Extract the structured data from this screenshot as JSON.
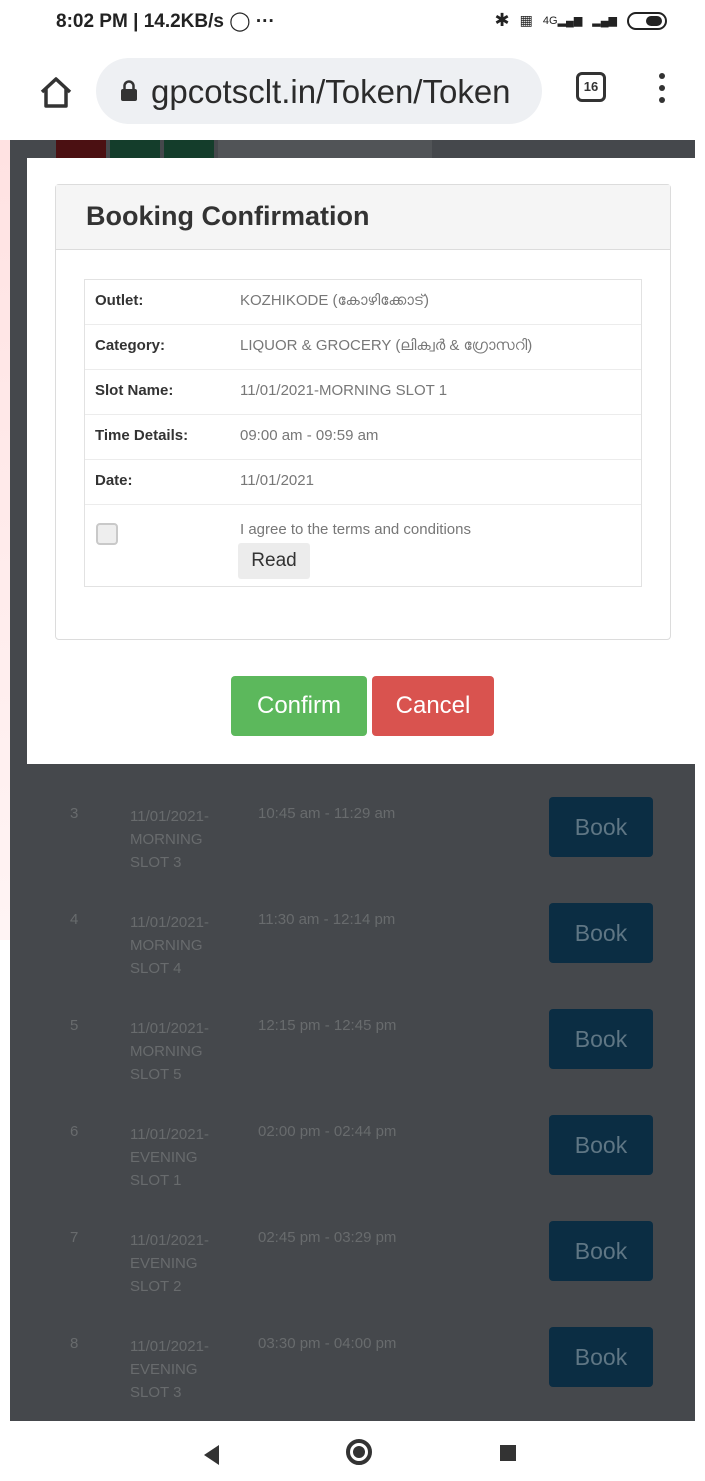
{
  "status_bar": {
    "time": "8:02 PM",
    "speed": "14.2KB/s",
    "more": "···",
    "signal_label": "4G"
  },
  "browser": {
    "url": "gpcotsclt.in/Token/Token",
    "tab_count": "16"
  },
  "modal": {
    "title": "Booking Confirmation",
    "details": [
      {
        "label": "Outlet:",
        "value": "KOZHIKODE (കോഴിക്കോട്)"
      },
      {
        "label": "Category:",
        "value": "LIQUOR & GROCERY (ലിക്വർ & ഗ്രോസറി)"
      },
      {
        "label": "Slot Name:",
        "value": "11/01/2021-MORNING SLOT 1"
      },
      {
        "label": "Time Details:",
        "value": "09:00 am - 09:59 am"
      },
      {
        "label": "Date:",
        "value": "11/01/2021"
      }
    ],
    "agree_text": "I agree to the terms and conditions",
    "read_label": "Read",
    "confirm_label": "Confirm",
    "cancel_label": "Cancel"
  },
  "slots": [
    {
      "num": "3",
      "name": "11/01/2021-MORNING SLOT 3",
      "time": "10:45 am - 11:29 am",
      "button": "Book"
    },
    {
      "num": "4",
      "name": "11/01/2021-MORNING SLOT 4",
      "time": "11:30 am - 12:14 pm",
      "button": "Book"
    },
    {
      "num": "5",
      "name": "11/01/2021-MORNING SLOT 5",
      "time": "12:15 pm - 12:45 pm",
      "button": "Book"
    },
    {
      "num": "6",
      "name": "11/01/2021-EVENING SLOT 1",
      "time": "02:00 pm - 02:44 pm",
      "button": "Book"
    },
    {
      "num": "7",
      "name": "11/01/2021-EVENING SLOT 2",
      "time": "02:45 pm - 03:29 pm",
      "button": "Book"
    },
    {
      "num": "8",
      "name": "11/01/2021-EVENING SLOT 3",
      "time": "03:30 pm - 04:00 pm",
      "button": "Book"
    }
  ],
  "colors": {
    "confirm": "#5cb85c",
    "cancel": "#d9534f",
    "book_button": "#0b2d43",
    "overlay": "#45484c"
  }
}
